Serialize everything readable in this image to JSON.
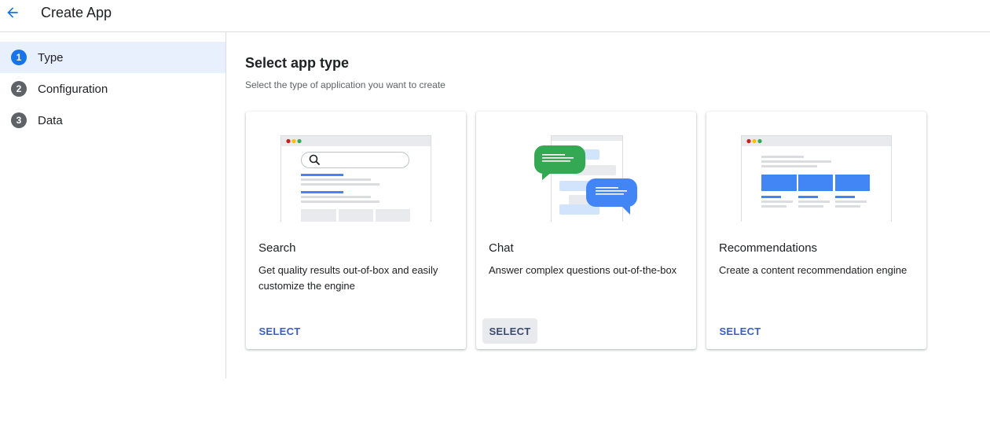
{
  "header": {
    "title": "Create App",
    "back_icon": "arrow-back-icon",
    "accent": "#1a73e8"
  },
  "steps": [
    {
      "number": "1",
      "label": "Type",
      "active": true
    },
    {
      "number": "2",
      "label": "Configuration",
      "active": false
    },
    {
      "number": "3",
      "label": "Data",
      "active": false
    }
  ],
  "main": {
    "title": "Select app type",
    "subtitle": "Select the type of application you want to create"
  },
  "cards": [
    {
      "title": "Search",
      "description": "Get quality results out-of-box and easily customize the engine",
      "button": "SELECT"
    },
    {
      "title": "Chat",
      "description": "Answer complex questions out-of-the-box",
      "button": "SELECT"
    },
    {
      "title": "Recommendations",
      "description": "Create a content recommendation engine",
      "button": "SELECT"
    }
  ],
  "colors": {
    "primary_blue": "#4285f4",
    "chat_green": "#34a853",
    "select_text": "#3c5ebf",
    "step_active_bg": "#e8f0fe"
  }
}
